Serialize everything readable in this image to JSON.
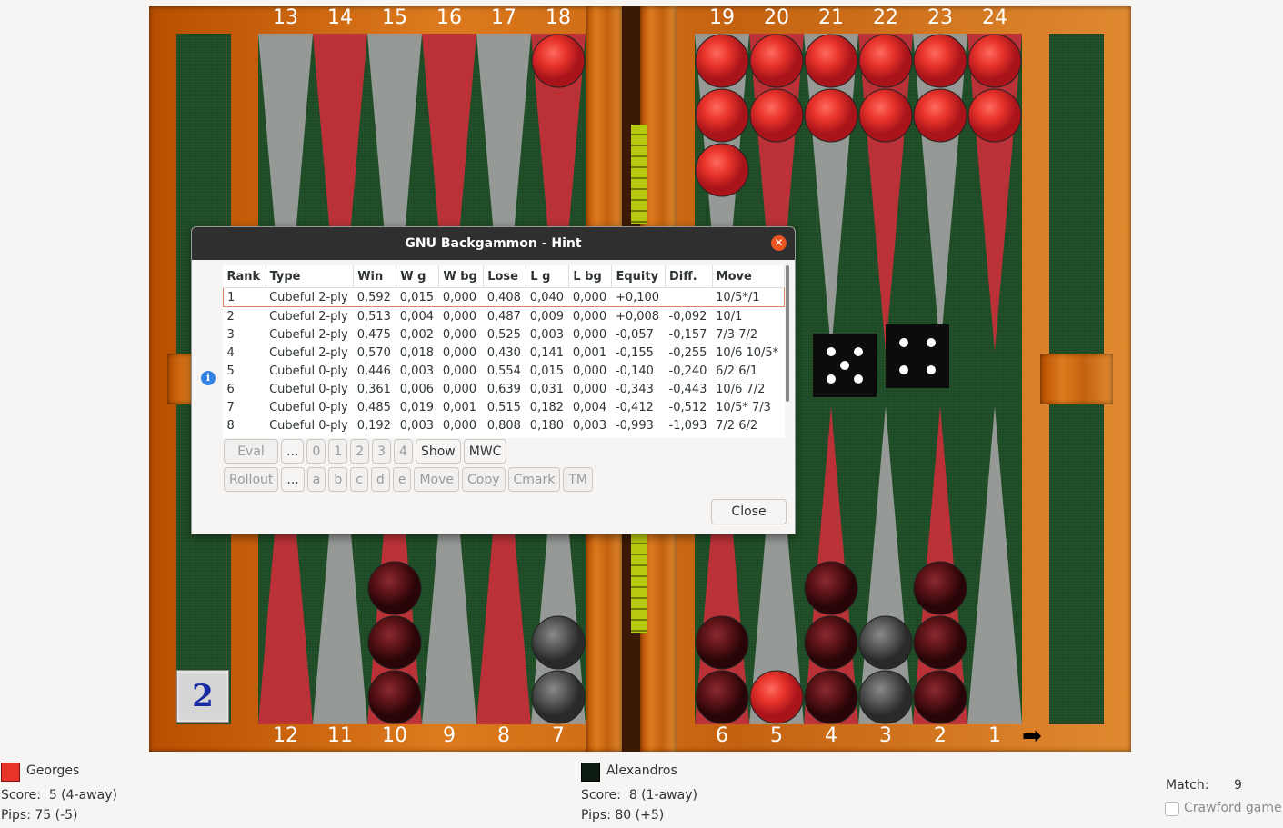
{
  "board": {
    "top_points": [
      "13",
      "14",
      "15",
      "16",
      "17",
      "18",
      "19",
      "20",
      "21",
      "22",
      "23",
      "24"
    ],
    "bottom_points": [
      "12",
      "11",
      "10",
      "9",
      "8",
      "7",
      "6",
      "5",
      "4",
      "3",
      "2",
      "1"
    ],
    "cube_value": "2",
    "dice": [
      5,
      4
    ],
    "colors": {
      "red_checker": "#e8332b",
      "dark_checker": "#5e1418",
      "felt": "#1c4a24",
      "triangle_red": "#c8303a",
      "triangle_grey": "#a0a0a0"
    }
  },
  "dialog": {
    "title": "GNU Backgammon - Hint",
    "columns": [
      "Rank",
      "Type",
      "Win",
      "W g",
      "W bg",
      "Lose",
      "L g",
      "L bg",
      "Equity",
      "Diff.",
      "Move"
    ],
    "rows": [
      [
        "1",
        "Cubeful 2-ply",
        "0,592",
        "0,015",
        "0,000",
        "0,408",
        "0,040",
        "0,000",
        "+0,100",
        "",
        "10/5*/1"
      ],
      [
        "2",
        "Cubeful 2-ply",
        "0,513",
        "0,004",
        "0,000",
        "0,487",
        "0,009",
        "0,000",
        "+0,008",
        "-0,092",
        "10/1"
      ],
      [
        "3",
        "Cubeful 2-ply",
        "0,475",
        "0,002",
        "0,000",
        "0,525",
        "0,003",
        "0,000",
        "-0,057",
        "-0,157",
        "7/3 7/2"
      ],
      [
        "4",
        "Cubeful 2-ply",
        "0,570",
        "0,018",
        "0,000",
        "0,430",
        "0,141",
        "0,001",
        "-0,155",
        "-0,255",
        "10/6 10/5*"
      ],
      [
        "5",
        "Cubeful 0-ply",
        "0,446",
        "0,003",
        "0,000",
        "0,554",
        "0,015",
        "0,000",
        "-0,140",
        "-0,240",
        "6/2 6/1"
      ],
      [
        "6",
        "Cubeful 0-ply",
        "0,361",
        "0,006",
        "0,000",
        "0,639",
        "0,031",
        "0,000",
        "-0,343",
        "-0,443",
        "10/6 7/2"
      ],
      [
        "7",
        "Cubeful 0-ply",
        "0,485",
        "0,019",
        "0,001",
        "0,515",
        "0,182",
        "0,004",
        "-0,412",
        "-0,512",
        "10/5* 7/3"
      ],
      [
        "8",
        "Cubeful 0-ply",
        "0,192",
        "0,003",
        "0,000",
        "0,808",
        "0,180",
        "0,003",
        "-0,993",
        "-1,093",
        "7/2 6/2"
      ]
    ],
    "row1_buttons": [
      "Eval",
      "...",
      "0",
      "1",
      "2",
      "3",
      "4",
      "Show",
      "MWC"
    ],
    "row2_buttons": [
      "Rollout",
      "...",
      "a",
      "b",
      "c",
      "d",
      "e",
      "Move",
      "Copy",
      "Cmark",
      "TM"
    ],
    "close_label": "Close"
  },
  "players": {
    "p1": {
      "name": "Georges",
      "score": "Score:  5 (4-away)",
      "pips": "Pips: 75 (-5)"
    },
    "p2": {
      "name": "Alexandros",
      "score": "Score:  8 (1-away)",
      "pips": "Pips: 80 (+5)"
    }
  },
  "match": {
    "label": "Match:",
    "value": "9",
    "crawford_label": "Crawford game"
  }
}
